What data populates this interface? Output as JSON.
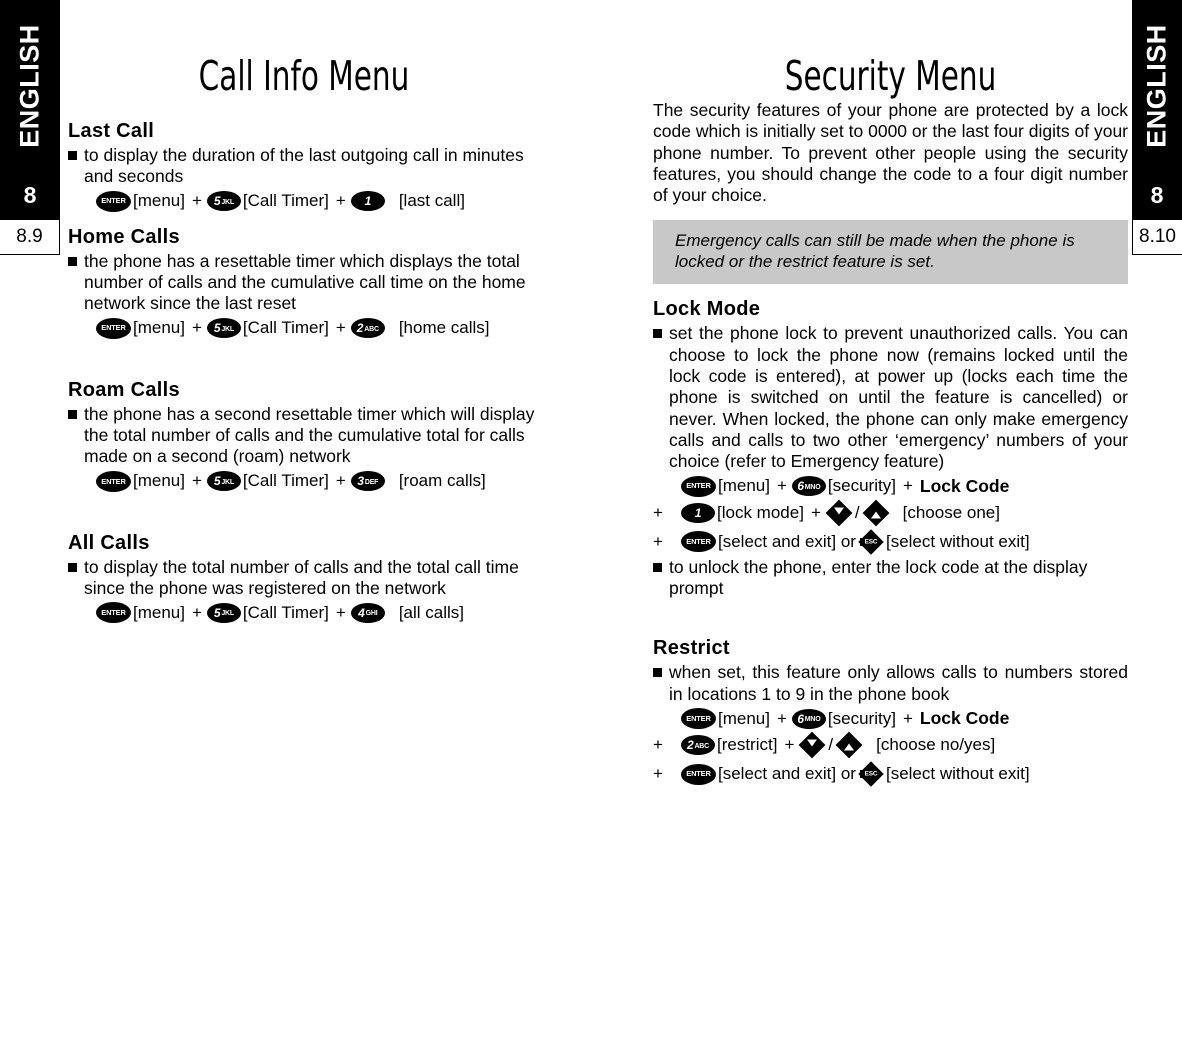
{
  "tabs": {
    "left": {
      "language": "ENGLISH",
      "chapter": "8",
      "page": "8.9"
    },
    "right": {
      "language": "ENGLISH",
      "chapter": "8",
      "page": "8.10"
    }
  },
  "left_column": {
    "title": "Call Info Menu",
    "sections": [
      {
        "heading": "Last Call",
        "bullets": [
          "to display the duration of the last outgoing call in minutes and seconds"
        ],
        "keyrows": [
          {
            "indent": "",
            "items": [
              {
                "type": "key",
                "key": "enter",
                "label": "ENTER"
              },
              {
                "type": "text",
                "text": "[menu]"
              },
              {
                "type": "plus",
                "text": "+"
              },
              {
                "type": "key",
                "key": "num",
                "num": "5",
                "sub": "JKL"
              },
              {
                "type": "text",
                "text": "[Call Timer]"
              },
              {
                "type": "plus",
                "text": "+"
              },
              {
                "type": "key",
                "key": "num",
                "num": "1",
                "sub": ""
              },
              {
                "type": "gap"
              },
              {
                "type": "text",
                "text": "[last call]"
              }
            ]
          }
        ]
      },
      {
        "heading": "Home Calls",
        "bullets": [
          "the phone has a resettable timer which displays the total number of calls and the cumulative call time on the home network since the last reset"
        ],
        "keyrows": [
          {
            "indent": "",
            "items": [
              {
                "type": "key",
                "key": "enter",
                "label": "ENTER"
              },
              {
                "type": "text",
                "text": "[menu]"
              },
              {
                "type": "plus",
                "text": "+"
              },
              {
                "type": "key",
                "key": "num",
                "num": "5",
                "sub": "JKL"
              },
              {
                "type": "text",
                "text": "[Call Timer]"
              },
              {
                "type": "plus",
                "text": "+"
              },
              {
                "type": "key",
                "key": "num",
                "num": "2",
                "sub": "ABC"
              },
              {
                "type": "gap"
              },
              {
                "type": "text",
                "text": "[home calls]"
              }
            ]
          }
        ]
      },
      {
        "heading": "Roam Calls",
        "bullets": [
          "the phone has a second resettable timer which will display the total number of calls and the cumulative total for calls made on a second (roam) network"
        ],
        "keyrows": [
          {
            "indent": "",
            "items": [
              {
                "type": "key",
                "key": "enter",
                "label": "ENTER"
              },
              {
                "type": "text",
                "text": "[menu]"
              },
              {
                "type": "plus",
                "text": "+"
              },
              {
                "type": "key",
                "key": "num",
                "num": "5",
                "sub": "JKL"
              },
              {
                "type": "text",
                "text": "[Call Timer]"
              },
              {
                "type": "plus",
                "text": "+"
              },
              {
                "type": "key",
                "key": "num",
                "num": "3",
                "sub": "DEF"
              },
              {
                "type": "gap"
              },
              {
                "type": "text",
                "text": "[roam calls]"
              }
            ]
          }
        ]
      },
      {
        "heading": "All Calls",
        "bullets": [
          "to display the total number of calls and the total call time since the phone was registered on the network"
        ],
        "keyrows": [
          {
            "indent": "",
            "items": [
              {
                "type": "key",
                "key": "enter",
                "label": "ENTER"
              },
              {
                "type": "text",
                "text": "[menu]"
              },
              {
                "type": "plus",
                "text": "+"
              },
              {
                "type": "key",
                "key": "num",
                "num": "5",
                "sub": "JKL"
              },
              {
                "type": "text",
                "text": "[Call Timer]"
              },
              {
                "type": "plus",
                "text": "+"
              },
              {
                "type": "key",
                "key": "num",
                "num": "4",
                "sub": "GHI"
              },
              {
                "type": "gap"
              },
              {
                "type": "text",
                "text": "[all calls]"
              }
            ]
          }
        ]
      }
    ]
  },
  "right_column": {
    "title": "Security Menu",
    "intro": "The security features of your phone are protected by a lock code which is initially set to 0000 or the last four digits of your phone number. To prevent other people using the security features, you should change the code to a four digit number of your choice.",
    "note": "Emergency calls can still be made when the phone is locked or the restrict feature is set.",
    "note_bg": "#c8c8c8",
    "sections": [
      {
        "heading": "Lock Mode",
        "bullets": [
          "set the phone lock to prevent unauthorized calls. You can choose to lock the phone now (remains locked until the lock code is entered), at power up (locks each time the phone is switched on until the feature is cancelled) or never. When locked, the phone can only make emergency calls and calls to two other ‘emergency’ numbers of your choice (refer to Emergency feature)"
        ],
        "keyrows": [
          {
            "indent": "",
            "items": [
              {
                "type": "key",
                "key": "enter",
                "label": "ENTER"
              },
              {
                "type": "text",
                "text": "[menu]"
              },
              {
                "type": "plus",
                "text": "+"
              },
              {
                "type": "key",
                "key": "num",
                "num": "6",
                "sub": "MNO"
              },
              {
                "type": "text",
                "text": "[security]"
              },
              {
                "type": "plus",
                "text": "+"
              },
              {
                "type": "bold",
                "text": "Lock Code"
              }
            ]
          },
          {
            "indent": "+",
            "items": [
              {
                "type": "key",
                "key": "num",
                "num": "1",
                "sub": ""
              },
              {
                "type": "text",
                "text": "[lock mode]"
              },
              {
                "type": "plus",
                "text": "+"
              },
              {
                "type": "key",
                "key": "arrow-down"
              },
              {
                "type": "slash",
                "text": "/"
              },
              {
                "type": "key",
                "key": "arrow-up"
              },
              {
                "type": "gap"
              },
              {
                "type": "text",
                "text": "[choose one]"
              }
            ]
          },
          {
            "indent": "+",
            "items": [
              {
                "type": "key",
                "key": "enter",
                "label": "ENTER"
              },
              {
                "type": "text",
                "text": "[select and exit] or"
              },
              {
                "type": "key",
                "key": "esc"
              },
              {
                "type": "text",
                "text": "[select without exit]"
              }
            ]
          }
        ],
        "bullets_after": [
          "to unlock the phone, enter the lock code at the display prompt"
        ]
      },
      {
        "heading": "Restrict",
        "bullets": [
          "when set, this feature only allows calls to numbers stored in locations 1 to 9 in the phone book"
        ],
        "keyrows": [
          {
            "indent": "",
            "items": [
              {
                "type": "key",
                "key": "enter",
                "label": "ENTER"
              },
              {
                "type": "text",
                "text": "[menu]"
              },
              {
                "type": "plus",
                "text": "+"
              },
              {
                "type": "key",
                "key": "num",
                "num": "6",
                "sub": "MNO"
              },
              {
                "type": "text",
                "text": "[security]"
              },
              {
                "type": "plus",
                "text": "+"
              },
              {
                "type": "bold",
                "text": "Lock Code"
              }
            ]
          },
          {
            "indent": "+",
            "items": [
              {
                "type": "key",
                "key": "num",
                "num": "2",
                "sub": "ABC"
              },
              {
                "type": "text",
                "text": "[restrict]"
              },
              {
                "type": "plus",
                "text": "+"
              },
              {
                "type": "key",
                "key": "arrow-down"
              },
              {
                "type": "slash",
                "text": "/"
              },
              {
                "type": "key",
                "key": "arrow-up"
              },
              {
                "type": "gap"
              },
              {
                "type": "text",
                "text": "[choose no/yes]"
              }
            ]
          },
          {
            "indent": "+",
            "items": [
              {
                "type": "key",
                "key": "enter",
                "label": "ENTER"
              },
              {
                "type": "text",
                "text": "[select and exit] or"
              },
              {
                "type": "key",
                "key": "esc"
              },
              {
                "type": "text",
                "text": "[select without exit]"
              }
            ]
          }
        ]
      }
    ]
  }
}
